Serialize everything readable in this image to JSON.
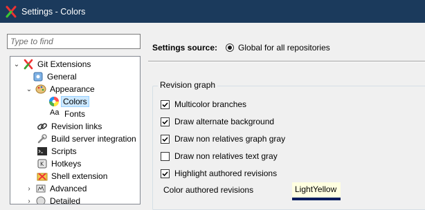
{
  "window": {
    "title": "Settings - Colors"
  },
  "search": {
    "placeholder": "Type to find"
  },
  "tree": {
    "items": [
      {
        "label": "Git Extensions",
        "icon": "git-extensions-icon"
      },
      {
        "label": "General",
        "icon": "general-icon"
      },
      {
        "label": "Appearance",
        "icon": "appearance-icon"
      },
      {
        "label": "Colors",
        "icon": "colors-icon",
        "selected": true
      },
      {
        "label": "Fonts",
        "icon": "fonts-icon"
      },
      {
        "label": "Revision links",
        "icon": "link-icon"
      },
      {
        "label": "Build server integration",
        "icon": "build-server-icon"
      },
      {
        "label": "Scripts",
        "icon": "scripts-icon"
      },
      {
        "label": "Hotkeys",
        "icon": "hotkeys-icon"
      },
      {
        "label": "Shell extension",
        "icon": "shell-extension-icon"
      },
      {
        "label": "Advanced",
        "icon": "advanced-icon"
      },
      {
        "label": "Detailed",
        "icon": "detailed-icon"
      }
    ]
  },
  "settings_source": {
    "label": "Settings source:",
    "selected_option": "Global for all repositories"
  },
  "revision_graph": {
    "title": "Revision graph",
    "options": [
      {
        "label": "Multicolor branches",
        "checked": true
      },
      {
        "label": "Draw alternate background",
        "checked": true
      },
      {
        "label": "Draw non relatives graph gray",
        "checked": true
      },
      {
        "label": "Draw non relatives text gray",
        "checked": false
      },
      {
        "label": "Highlight authored revisions",
        "checked": true
      }
    ],
    "color_authored": {
      "label": "Color authored revisions",
      "value": "LightYellow"
    }
  },
  "colors": {
    "titlebar": "#1b3a5c",
    "selection": "#cce8ff",
    "swatch": "#ffffe0",
    "swatch_border": "#001d5c"
  }
}
